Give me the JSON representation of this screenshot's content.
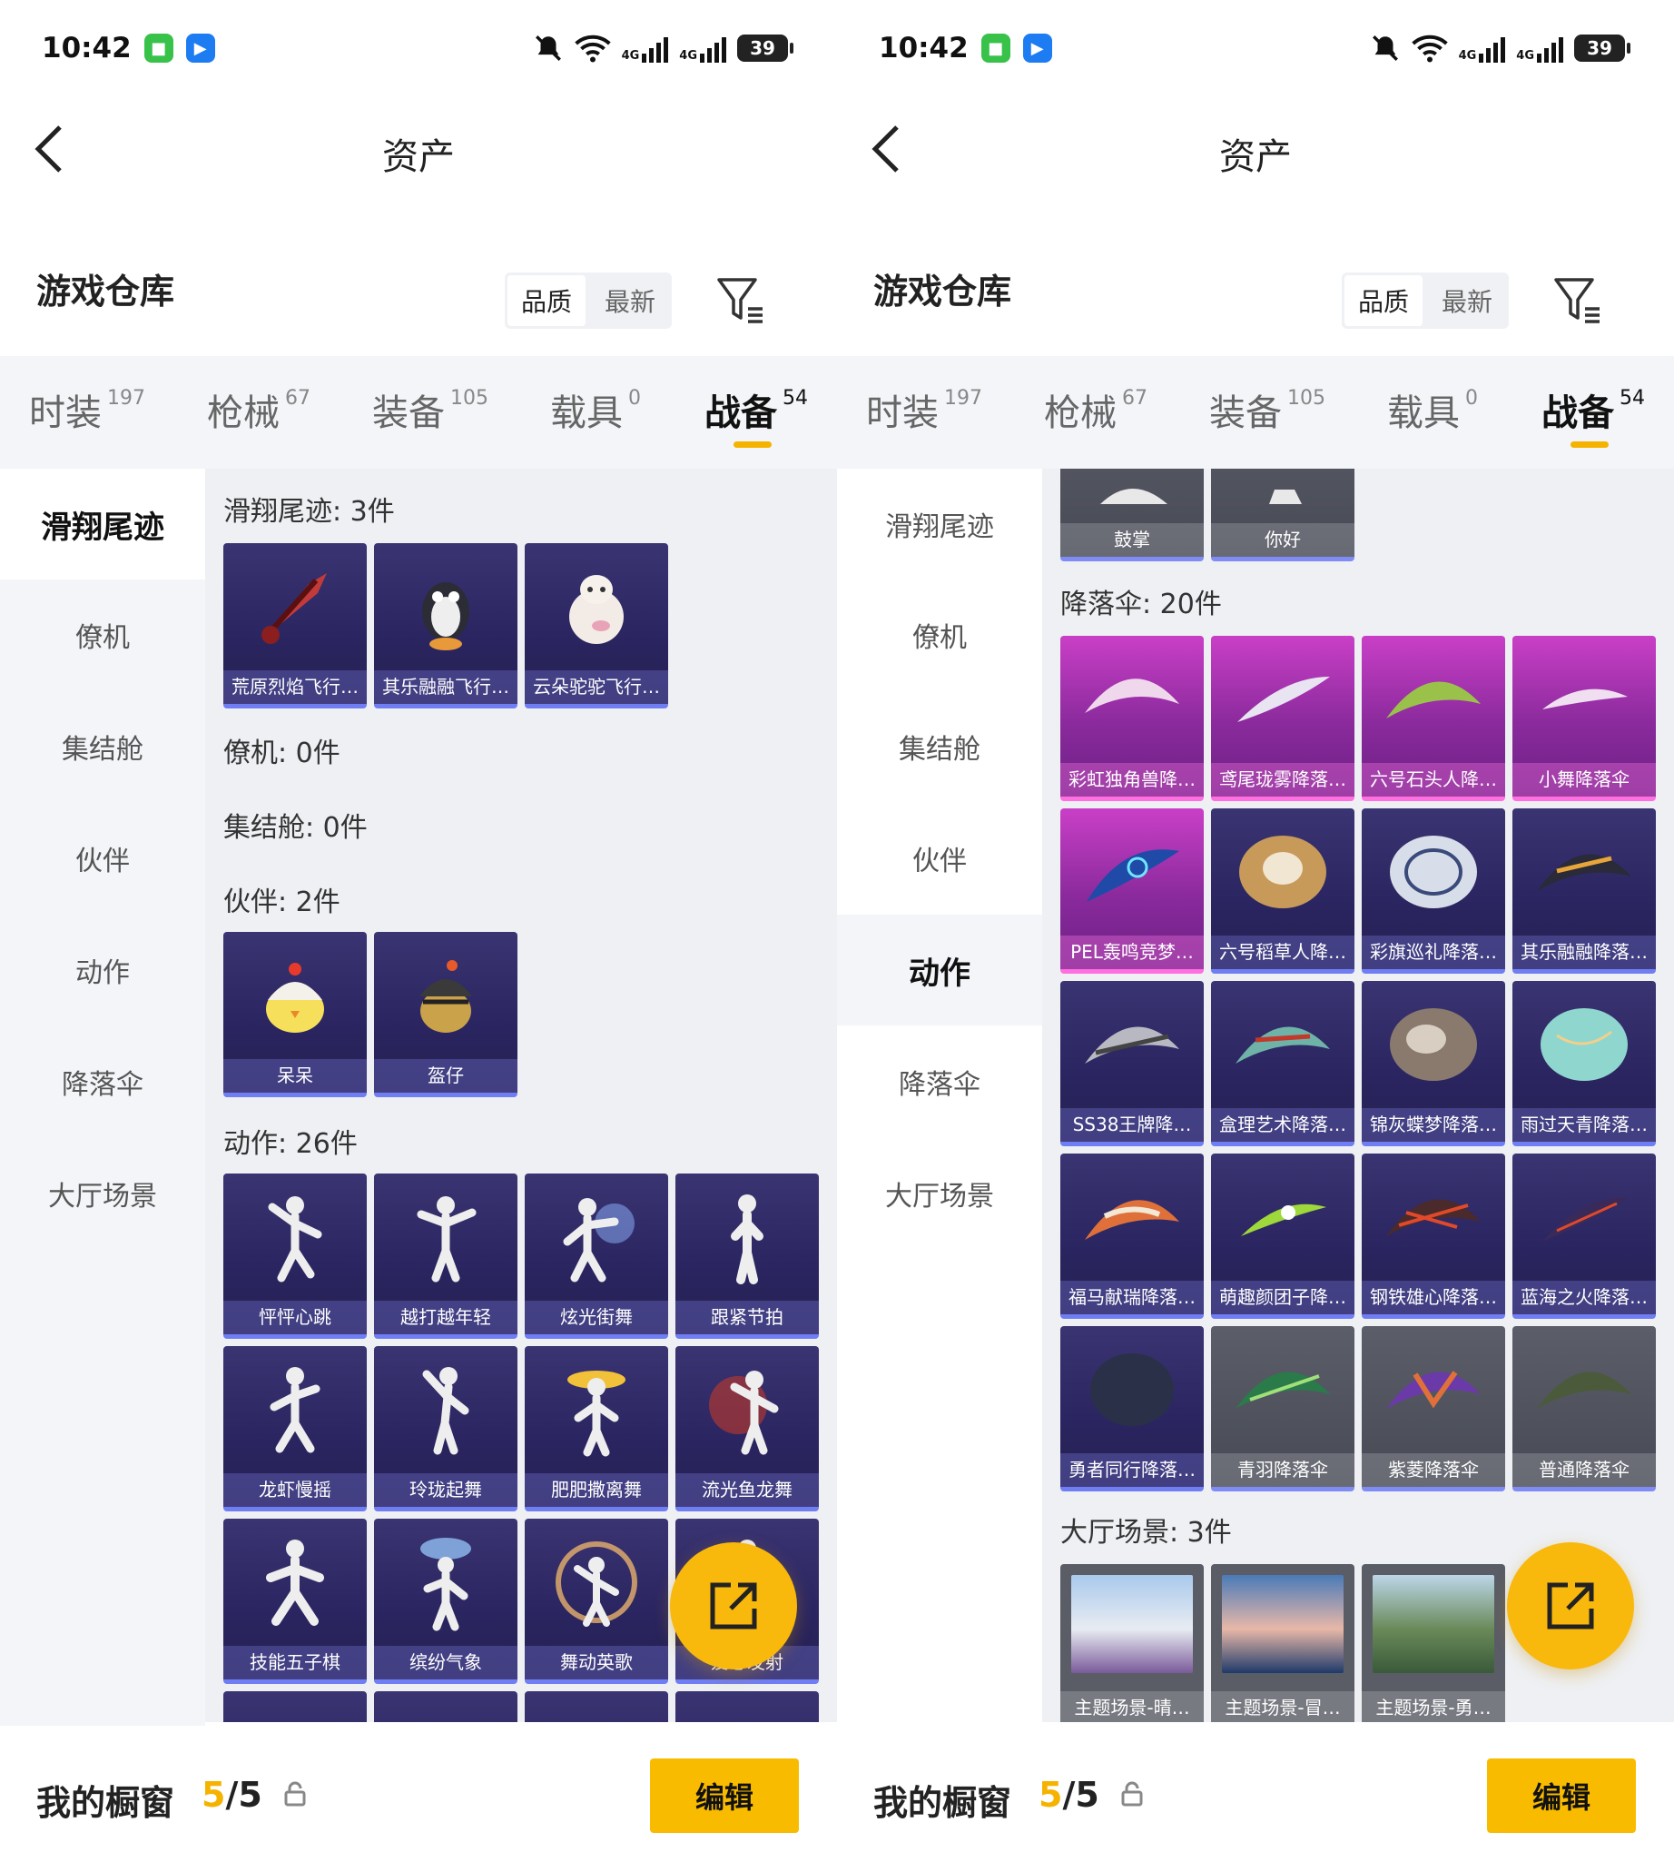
{
  "status": {
    "time": "10:42",
    "battery": "39",
    "net1": "4G",
    "net2": "4G"
  },
  "header": {
    "title": "资产",
    "warehouse": "游戏仓库",
    "sort_quality": "品质",
    "sort_latest": "最新"
  },
  "tabs": [
    {
      "label": "时装",
      "count": "197"
    },
    {
      "label": "枪械",
      "count": "67"
    },
    {
      "label": "装备",
      "count": "105"
    },
    {
      "label": "载具",
      "count": "0"
    },
    {
      "label": "战备",
      "count": "54"
    }
  ],
  "sidebar": [
    "滑翔尾迹",
    "僚机",
    "集结舱",
    "伙伴",
    "动作",
    "降落伞",
    "大厅场景"
  ],
  "left": {
    "sections": {
      "trail": "滑翔尾迹: 3件",
      "wingman": "僚机: 0件",
      "pod": "集结舱: 0件",
      "partner": "伙伴: 2件",
      "emote": "动作: 26件"
    },
    "trail_items": [
      "荒原烈焰飞行…",
      "其乐融融飞行…",
      "云朵驼驼飞行…"
    ],
    "partner_items": [
      "呆呆",
      "盔仔"
    ],
    "emote_items": [
      "怦怦心跳",
      "越打越年轻",
      "炫光街舞",
      "跟紧节拍",
      "龙虾慢摇",
      "玲珑起舞",
      "肥肥撒离舞",
      "流光鱼龙舞",
      "技能五子棋",
      "缤纷气象",
      "舞动英歌",
      "爱心发射"
    ]
  },
  "right": {
    "sections": {
      "parachute": "降落伞: 20件",
      "scene": "大厅场景: 3件"
    },
    "top_items": [
      "鼓掌",
      "你好"
    ],
    "parachute_items": [
      "彩虹独角兽降…",
      "鸢尾珑雾降落…",
      "六号石头人降…",
      "小舞降落伞",
      "PEL轰鸣竞梦…",
      "六号稻草人降…",
      "彩旗巡礼降落…",
      "其乐融融降落…",
      "SS38王牌降…",
      "盒理艺术降落…",
      "锦灰蝶梦降落…",
      "雨过天青降落…",
      "福马献瑞降落…",
      "萌趣颜团子降…",
      "钢铁雄心降落…",
      "蓝海之火降落…",
      "勇者同行降落…",
      "青羽降落伞",
      "紫菱降落伞",
      "普通降落伞"
    ],
    "scene_items": [
      "主题场景-晴…",
      "主题场景-冒…",
      "主题场景-勇…"
    ]
  },
  "bottom": {
    "window_label": "我的橱窗",
    "count_current": "5",
    "count_total": "/5",
    "edit_label": "编辑"
  },
  "colors": {
    "accent": "#f9bb00",
    "card_purple": "#2a2560",
    "card_pink": "#c93fc7",
    "card_gray": "#4b4e59"
  },
  "icons": [
    "back-arrow-icon",
    "filter-icon",
    "share-icon",
    "lock-icon",
    "mute-icon",
    "wifi-icon",
    "signal-icon"
  ]
}
